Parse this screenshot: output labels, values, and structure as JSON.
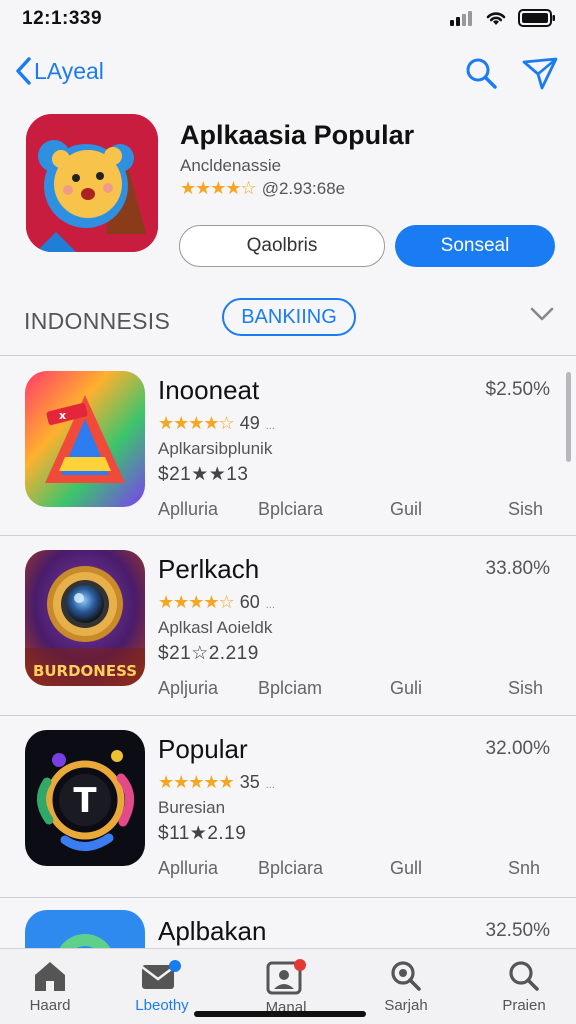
{
  "status": {
    "time": "12:1:339"
  },
  "nav": {
    "back_label": "LAyeal"
  },
  "hero": {
    "title": "Aplkaasia Popular",
    "subtitle": "Ancldenassie",
    "rating_stars": "★★★★☆",
    "rating_text": "@2.93:68e",
    "outline_button": "Qaolbris",
    "primary_button": "Sonseal"
  },
  "filter": {
    "left_label": "INDONNESIS",
    "pill_label": "BANKIING"
  },
  "items": [
    {
      "name": "Inooneat",
      "pct": "$2.50%",
      "stars": "★★★★☆",
      "rating": "49",
      "rating_dots": "...",
      "sub": "Aplkarsibplunik",
      "code": "$21★★13",
      "meta": [
        "Aplluria",
        "Bplciara",
        "Guil",
        "Sish"
      ]
    },
    {
      "name": "Perlkach",
      "pct": "33.80%",
      "stars": "★★★★☆",
      "rating": "60",
      "rating_dots": "...",
      "sub": "Aplkasl Aoieldk",
      "code": "$21☆2.219",
      "meta": [
        "Apljuria",
        "Bplciam",
        "Guli",
        "Sish"
      ]
    },
    {
      "name": "Popular",
      "pct": "32.00%",
      "stars": "★★★★★",
      "rating": "35",
      "rating_dots": "...",
      "sub": "Buresian",
      "code": "$11★2.19",
      "meta": [
        "Aplluria",
        "Bplciara",
        "Gull",
        "Snh"
      ]
    },
    {
      "name": "Aplbakan",
      "pct": "32.50%"
    }
  ],
  "hero_icon_text": "",
  "item2_icon_text": "BURDONESS",
  "tabs": [
    {
      "label": "Haard",
      "icon": "home-icon"
    },
    {
      "label": "Lbeothy",
      "icon": "mail-icon"
    },
    {
      "label": "Manal",
      "icon": "profile-icon"
    },
    {
      "label": "Sarjah",
      "icon": "search-icon"
    },
    {
      "label": "Praien",
      "icon": "search-icon"
    }
  ],
  "colors": {
    "accent": "#1a7cf2",
    "star": "#f5a623",
    "badge": "#e53935"
  }
}
